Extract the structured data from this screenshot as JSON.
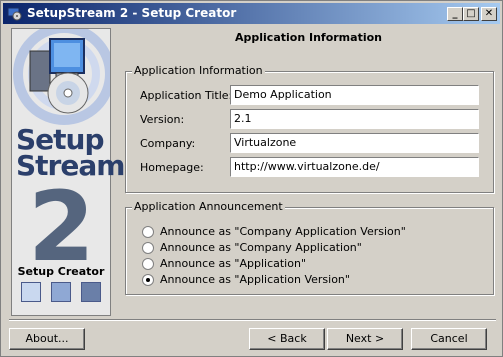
{
  "window": {
    "title": "SetupStream 2 - Setup Creator"
  },
  "titlebar_buttons": {
    "minimize": "_",
    "maximize": "□",
    "close": "✕"
  },
  "left_panel": {
    "logo_line1": "Setup",
    "logo_line2": "Stream",
    "logo_number": "2",
    "caption": "Setup Creator"
  },
  "page": {
    "title": "Application Information"
  },
  "app_info": {
    "legend": "Application Information",
    "fields": [
      {
        "label": "Application Title:",
        "value": "Demo Application"
      },
      {
        "label": "Version:",
        "value": "2.1"
      },
      {
        "label": "Company:",
        "value": "Virtualzone"
      },
      {
        "label": "Homepage:",
        "value": "http://www.virtualzone.de/"
      }
    ]
  },
  "announcement": {
    "legend": "Application Announcement",
    "options": [
      {
        "label": "Announce as \"Company Application Version\"",
        "checked": false
      },
      {
        "label": "Announce as \"Company Application\"",
        "checked": false
      },
      {
        "label": "Announce as \"Application\"",
        "checked": false
      },
      {
        "label": "Announce as \"Application Version\"",
        "checked": true
      }
    ]
  },
  "buttons": {
    "about": "About...",
    "back": "< Back",
    "next": "Next >",
    "cancel": "Cancel"
  }
}
